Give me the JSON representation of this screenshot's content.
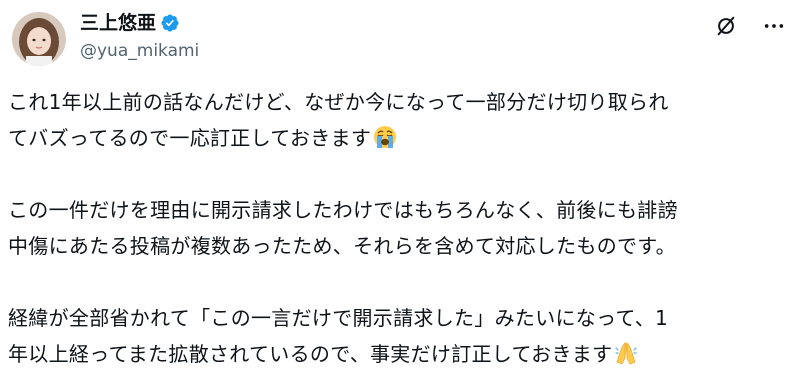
{
  "author": {
    "display_name": "三上悠亜",
    "handle": "@yua_mikami",
    "verified": true,
    "verified_color": "#1d9bf0"
  },
  "actions": {
    "grok_icon": "grok-icon",
    "more_icon": "more-icon"
  },
  "post": {
    "paragraphs": [
      {
        "line1": "これ1年以上前の話なんだけど、なぜか今になって一部分だけ切り取られ",
        "line2": "てバズってるので一応訂正しておきます",
        "emoji": "crying-face-emoji"
      },
      {
        "line1": "この一件だけを理由に開示請求したわけではもちろんなく、前後にも誹謗",
        "line2": "中傷にあたる投稿が複数あったため、それらを含めて対応したものです。"
      },
      {
        "line1": "経緯が全部省かれて「この一言だけで開示請求した」みたいになって、1",
        "line2": "年以上経ってまた拡散されているので、事実だけ訂正しておきます",
        "emoji": "folded-hands-emoji"
      }
    ]
  }
}
